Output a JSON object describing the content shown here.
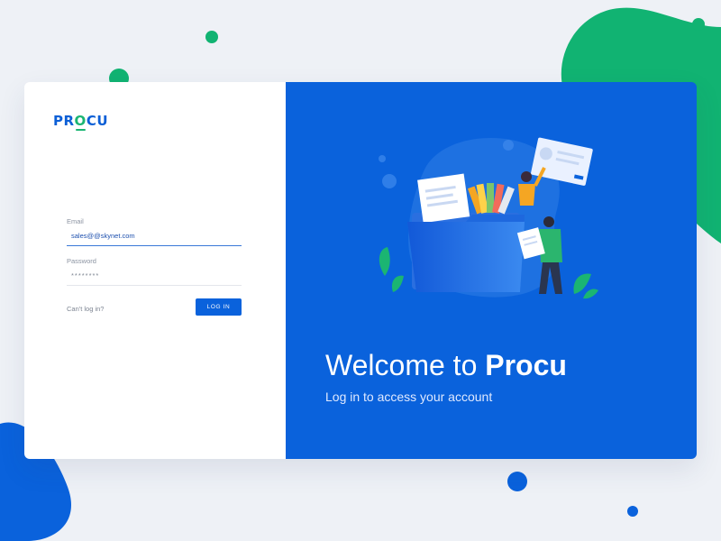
{
  "brand": {
    "logo_pre": "PR",
    "logo_o": "O",
    "logo_post": "CU"
  },
  "login": {
    "email_label": "Email",
    "email_value": "sales@@skynet.com",
    "password_label": "Password",
    "password_value": "********",
    "cant_login": "Can't log in?",
    "login_button": "LOG IN"
  },
  "hero": {
    "welcome_prefix": "Welcome to ",
    "welcome_brand": "Procu",
    "subtitle": "Log in to access your account"
  },
  "colors": {
    "primary": "#0a62dc",
    "accent_green": "#1bb572",
    "background": "#eef1f6"
  }
}
